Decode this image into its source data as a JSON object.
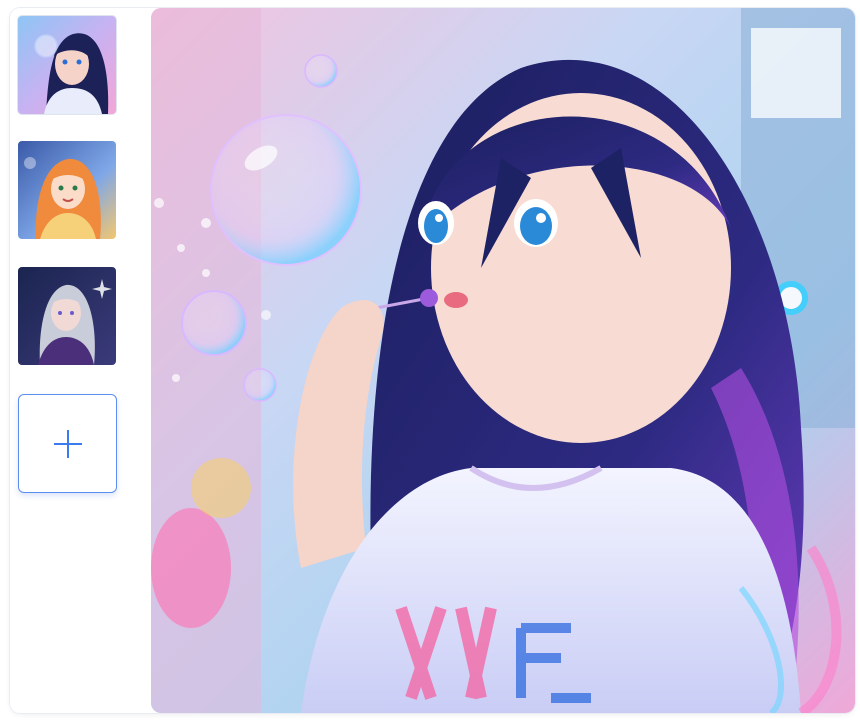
{
  "sidebar": {
    "thumbnails": [
      {
        "icon": "image-thumbnail-bubble-girl",
        "selected": true
      },
      {
        "icon": "image-thumbnail-orange-hair-girl",
        "selected": false
      },
      {
        "icon": "image-thumbnail-silver-hair-girl",
        "selected": false
      }
    ],
    "add_button": {
      "icon": "plus-icon",
      "color": "#3b7bf0"
    }
  },
  "preview": {
    "icon": "anime-girl-blowing-bubble-image"
  },
  "colors": {
    "accent": "#3b7bf0",
    "border": "#e9edf3"
  }
}
